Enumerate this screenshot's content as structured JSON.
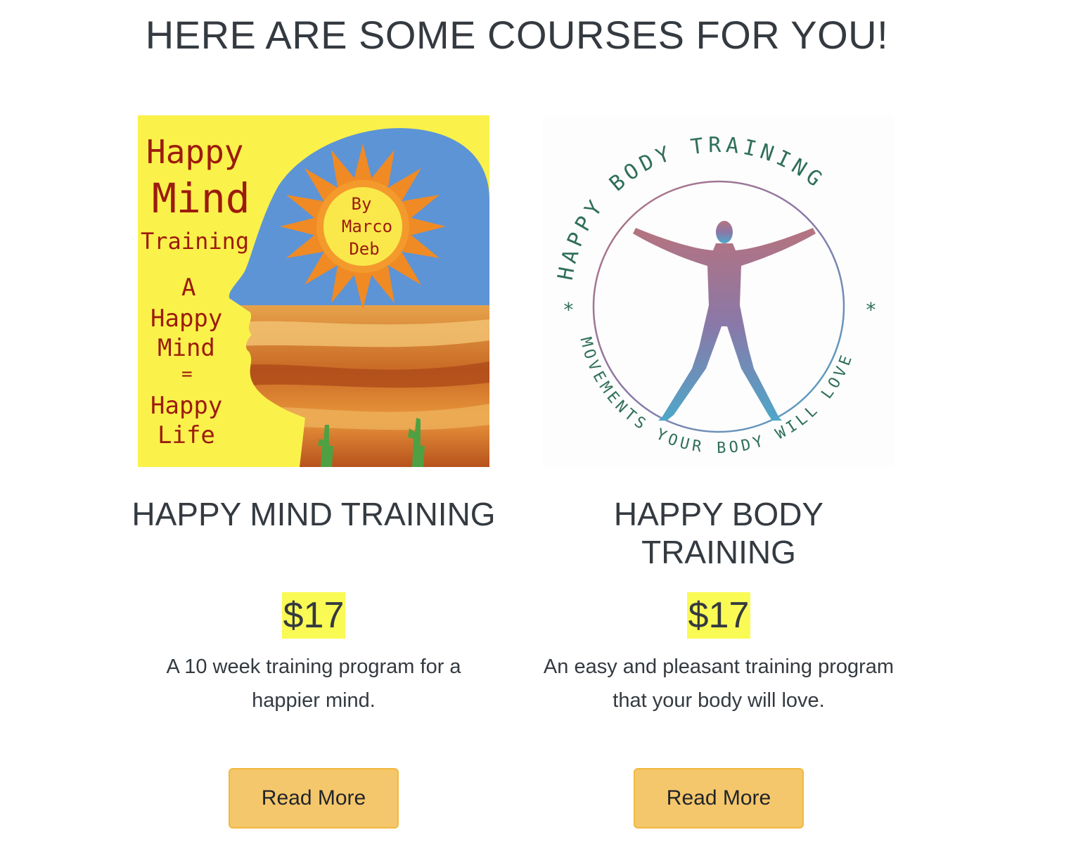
{
  "header": {
    "title": "HERE ARE SOME COURSES FOR YOU!"
  },
  "colors": {
    "price_highlight": "#fafa55",
    "button_bg": "#f5c76c",
    "button_border": "#f0b93f",
    "text": "#343a40"
  },
  "courses": [
    {
      "image": {
        "icon": "happy-mind-training-cover",
        "text_lines": [
          "Happy",
          "Mind",
          "Training",
          "A",
          "Happy",
          "Mind",
          "=",
          "Happy",
          "Life"
        ],
        "author_lines": [
          "By",
          "Marco",
          "Deb"
        ]
      },
      "title": "HAPPY MIND TRAINING",
      "price": "$17",
      "description": "A 10 week training program for a happier mind.",
      "button_label": "Read More"
    },
    {
      "image": {
        "icon": "happy-body-training-logo",
        "top_text": "HAPPY BODY TRAINING",
        "bottom_text": "MOVEMENTS YOUR BODY WILL LOVE",
        "star": "*"
      },
      "title": "HAPPY BODY TRAINING",
      "price": "$17",
      "description": "An easy and pleasant training program that your body will love.",
      "button_label": "Read More"
    }
  ]
}
